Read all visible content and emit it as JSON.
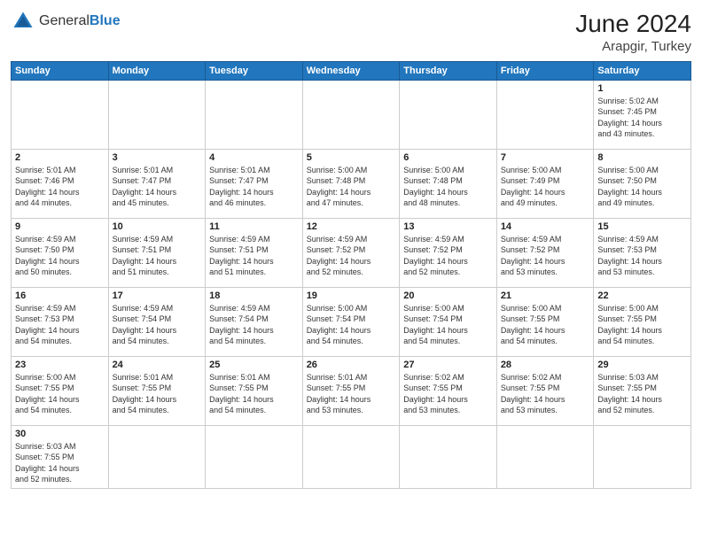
{
  "header": {
    "logo_general": "General",
    "logo_blue": "Blue",
    "month_year": "June 2024",
    "location": "Arapgir, Turkey"
  },
  "weekdays": [
    "Sunday",
    "Monday",
    "Tuesday",
    "Wednesday",
    "Thursday",
    "Friday",
    "Saturday"
  ],
  "weeks": [
    [
      {
        "date": "",
        "info": ""
      },
      {
        "date": "",
        "info": ""
      },
      {
        "date": "",
        "info": ""
      },
      {
        "date": "",
        "info": ""
      },
      {
        "date": "",
        "info": ""
      },
      {
        "date": "",
        "info": ""
      },
      {
        "date": "1",
        "info": "Sunrise: 5:02 AM\nSunset: 7:45 PM\nDaylight: 14 hours\nand 43 minutes."
      }
    ],
    [
      {
        "date": "2",
        "info": "Sunrise: 5:01 AM\nSunset: 7:46 PM\nDaylight: 14 hours\nand 44 minutes."
      },
      {
        "date": "3",
        "info": "Sunrise: 5:01 AM\nSunset: 7:47 PM\nDaylight: 14 hours\nand 45 minutes."
      },
      {
        "date": "4",
        "info": "Sunrise: 5:01 AM\nSunset: 7:47 PM\nDaylight: 14 hours\nand 46 minutes."
      },
      {
        "date": "5",
        "info": "Sunrise: 5:00 AM\nSunset: 7:48 PM\nDaylight: 14 hours\nand 47 minutes."
      },
      {
        "date": "6",
        "info": "Sunrise: 5:00 AM\nSunset: 7:48 PM\nDaylight: 14 hours\nand 48 minutes."
      },
      {
        "date": "7",
        "info": "Sunrise: 5:00 AM\nSunset: 7:49 PM\nDaylight: 14 hours\nand 49 minutes."
      },
      {
        "date": "8",
        "info": "Sunrise: 5:00 AM\nSunset: 7:50 PM\nDaylight: 14 hours\nand 49 minutes."
      }
    ],
    [
      {
        "date": "9",
        "info": "Sunrise: 4:59 AM\nSunset: 7:50 PM\nDaylight: 14 hours\nand 50 minutes."
      },
      {
        "date": "10",
        "info": "Sunrise: 4:59 AM\nSunset: 7:51 PM\nDaylight: 14 hours\nand 51 minutes."
      },
      {
        "date": "11",
        "info": "Sunrise: 4:59 AM\nSunset: 7:51 PM\nDaylight: 14 hours\nand 51 minutes."
      },
      {
        "date": "12",
        "info": "Sunrise: 4:59 AM\nSunset: 7:52 PM\nDaylight: 14 hours\nand 52 minutes."
      },
      {
        "date": "13",
        "info": "Sunrise: 4:59 AM\nSunset: 7:52 PM\nDaylight: 14 hours\nand 52 minutes."
      },
      {
        "date": "14",
        "info": "Sunrise: 4:59 AM\nSunset: 7:52 PM\nDaylight: 14 hours\nand 53 minutes."
      },
      {
        "date": "15",
        "info": "Sunrise: 4:59 AM\nSunset: 7:53 PM\nDaylight: 14 hours\nand 53 minutes."
      }
    ],
    [
      {
        "date": "16",
        "info": "Sunrise: 4:59 AM\nSunset: 7:53 PM\nDaylight: 14 hours\nand 54 minutes."
      },
      {
        "date": "17",
        "info": "Sunrise: 4:59 AM\nSunset: 7:54 PM\nDaylight: 14 hours\nand 54 minutes."
      },
      {
        "date": "18",
        "info": "Sunrise: 4:59 AM\nSunset: 7:54 PM\nDaylight: 14 hours\nand 54 minutes."
      },
      {
        "date": "19",
        "info": "Sunrise: 5:00 AM\nSunset: 7:54 PM\nDaylight: 14 hours\nand 54 minutes."
      },
      {
        "date": "20",
        "info": "Sunrise: 5:00 AM\nSunset: 7:54 PM\nDaylight: 14 hours\nand 54 minutes."
      },
      {
        "date": "21",
        "info": "Sunrise: 5:00 AM\nSunset: 7:55 PM\nDaylight: 14 hours\nand 54 minutes."
      },
      {
        "date": "22",
        "info": "Sunrise: 5:00 AM\nSunset: 7:55 PM\nDaylight: 14 hours\nand 54 minutes."
      }
    ],
    [
      {
        "date": "23",
        "info": "Sunrise: 5:00 AM\nSunset: 7:55 PM\nDaylight: 14 hours\nand 54 minutes."
      },
      {
        "date": "24",
        "info": "Sunrise: 5:01 AM\nSunset: 7:55 PM\nDaylight: 14 hours\nand 54 minutes."
      },
      {
        "date": "25",
        "info": "Sunrise: 5:01 AM\nSunset: 7:55 PM\nDaylight: 14 hours\nand 54 minutes."
      },
      {
        "date": "26",
        "info": "Sunrise: 5:01 AM\nSunset: 7:55 PM\nDaylight: 14 hours\nand 53 minutes."
      },
      {
        "date": "27",
        "info": "Sunrise: 5:02 AM\nSunset: 7:55 PM\nDaylight: 14 hours\nand 53 minutes."
      },
      {
        "date": "28",
        "info": "Sunrise: 5:02 AM\nSunset: 7:55 PM\nDaylight: 14 hours\nand 53 minutes."
      },
      {
        "date": "29",
        "info": "Sunrise: 5:03 AM\nSunset: 7:55 PM\nDaylight: 14 hours\nand 52 minutes."
      }
    ],
    [
      {
        "date": "30",
        "info": "Sunrise: 5:03 AM\nSunset: 7:55 PM\nDaylight: 14 hours\nand 52 minutes."
      },
      {
        "date": "",
        "info": ""
      },
      {
        "date": "",
        "info": ""
      },
      {
        "date": "",
        "info": ""
      },
      {
        "date": "",
        "info": ""
      },
      {
        "date": "",
        "info": ""
      },
      {
        "date": "",
        "info": ""
      }
    ]
  ]
}
